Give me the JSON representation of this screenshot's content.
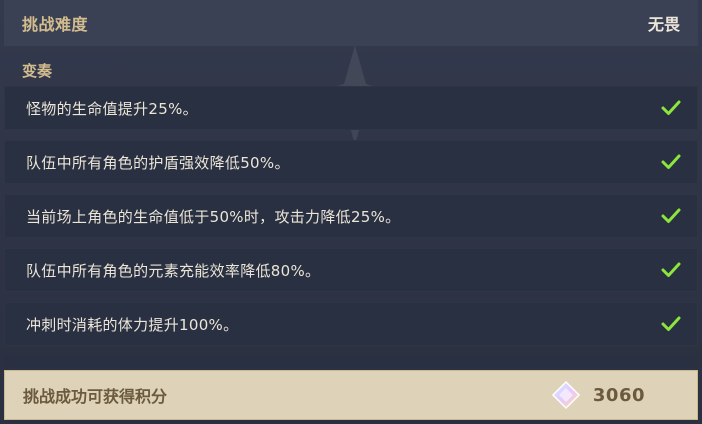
{
  "header": {
    "label": "挑战难度",
    "value": "无畏"
  },
  "section": {
    "title": "变奏"
  },
  "modifiers": [
    {
      "text": "怪物的生命值提升25%。",
      "checked": true
    },
    {
      "text": "队伍中所有角色的护盾强效降低50%。",
      "checked": true
    },
    {
      "text": "当前场上角色的生命值低于50%时，攻击力降低25%。",
      "checked": true
    },
    {
      "text": "队伍中所有角色的元素充能效率降低80%。",
      "checked": true
    },
    {
      "text": "冲刺时消耗的体力提升100%。",
      "checked": true
    }
  ],
  "score": {
    "label": "挑战成功可获得积分",
    "value": "3060",
    "icon": "crystal-icon"
  },
  "colors": {
    "gold_label": "#d3bc8e",
    "text_light": "#ece5d8",
    "check_green": "#8ce63c",
    "score_bar_bg": "#ded3b9",
    "score_text": "#6b5a3d"
  }
}
